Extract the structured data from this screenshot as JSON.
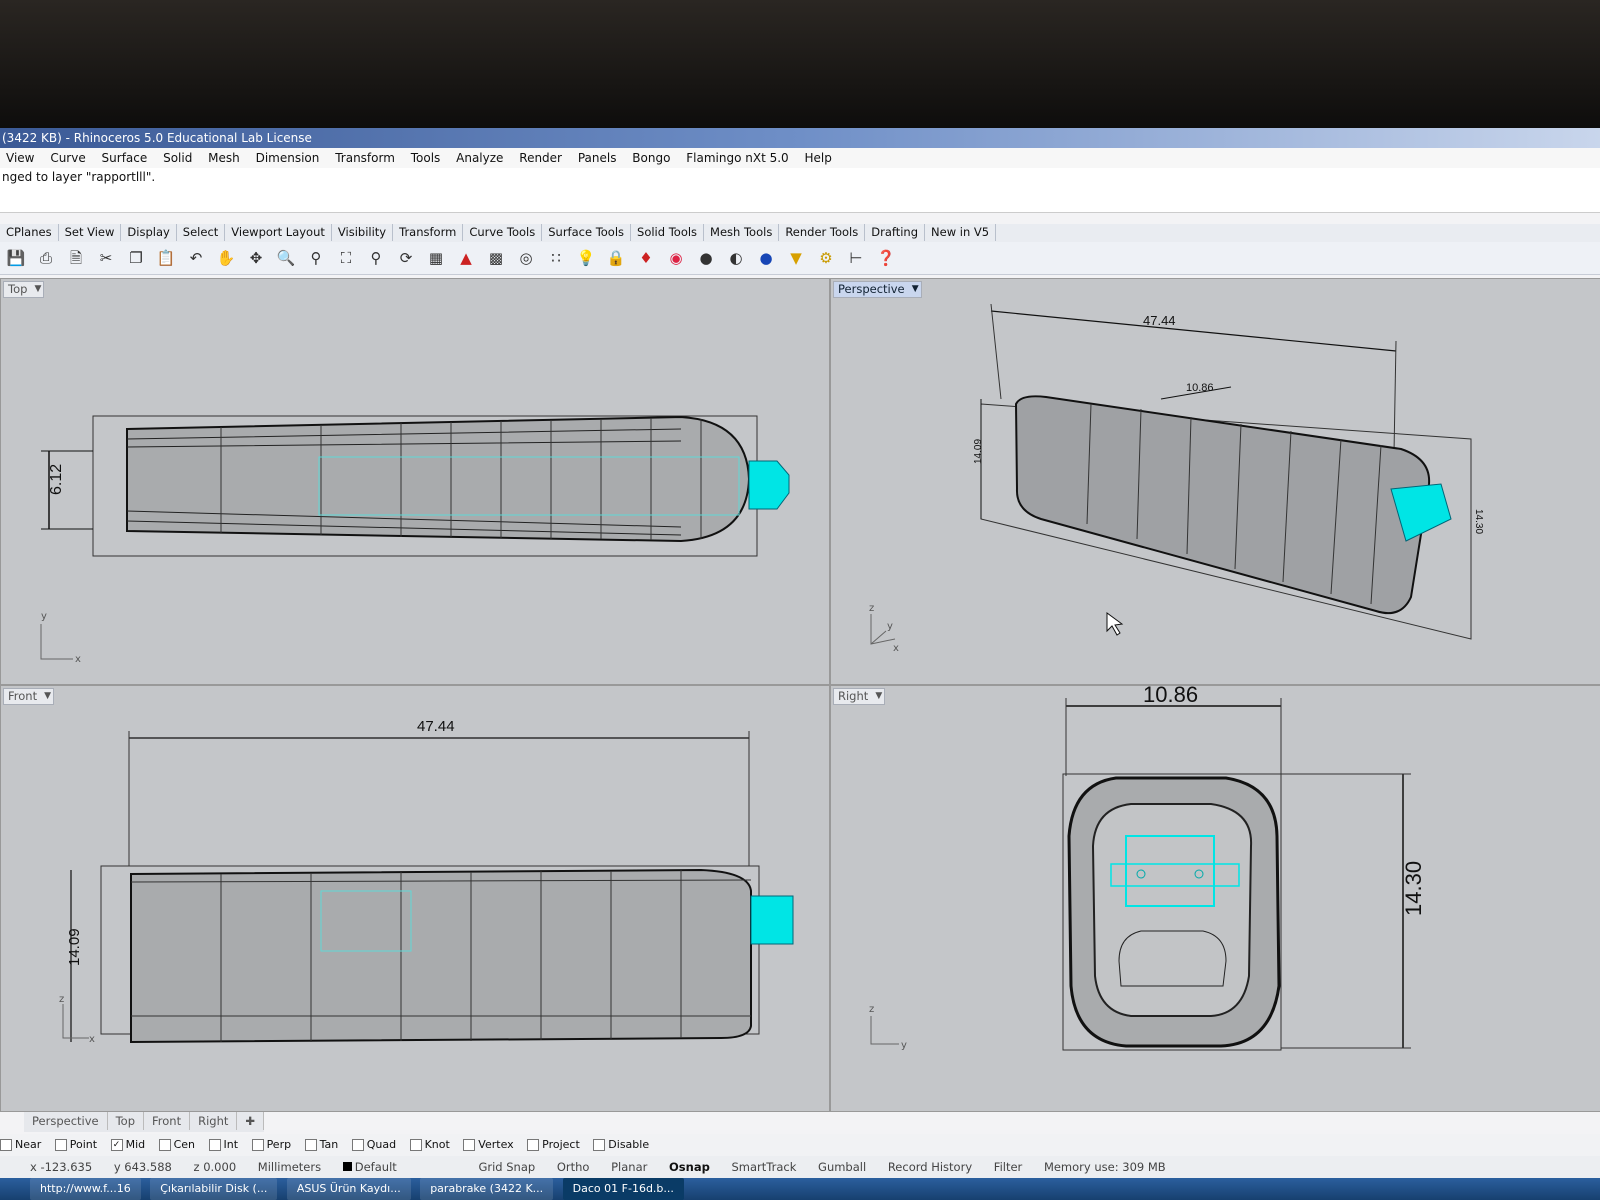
{
  "window": {
    "title": "(3422 KB) - Rhinoceros 5.0 Educational Lab License"
  },
  "menu": [
    "View",
    "Curve",
    "Surface",
    "Solid",
    "Mesh",
    "Dimension",
    "Transform",
    "Tools",
    "Analyze",
    "Render",
    "Panels",
    "Bongo",
    "Flamingo nXt 5.0",
    "Help"
  ],
  "command_history": "nged to layer \"rapportlll\".",
  "toolbar_tabs": [
    "CPlanes",
    "Set View",
    "Display",
    "Select",
    "Viewport Layout",
    "Visibility",
    "Transform",
    "Curve Tools",
    "Surface Tools",
    "Solid Tools",
    "Mesh Tools",
    "Render Tools",
    "Drafting",
    "New in V5"
  ],
  "toolbar_icons": [
    "save-icon",
    "print-icon",
    "new-doc-icon",
    "cut-icon",
    "copy-icon",
    "paste-icon",
    "undo-icon",
    "pan-hand-icon",
    "rotate-icon",
    "zoom-window-icon",
    "zoom-dynamic-icon",
    "zoom-extents-icon",
    "zoom-selected-icon",
    "rotate-view-icon",
    "four-view-icon",
    "car-icon",
    "grid-icon",
    "circle-snap-icon",
    "points-icon",
    "light-bulb-icon",
    "lock-icon",
    "layer-icon",
    "color-wheel-icon",
    "render-sphere-icon",
    "shaded-sphere-icon",
    "blue-sphere-icon",
    "cone-icon",
    "gear-icon",
    "dimension-icon",
    "help-icon"
  ],
  "viewports": {
    "top": {
      "label": "Top",
      "dims": [
        "6.12"
      ],
      "axes": [
        "y",
        "x"
      ]
    },
    "perspective": {
      "label": "Perspective",
      "dims": [
        "47.44",
        "10.86",
        "14.09",
        "14.30"
      ],
      "axes": [
        "z",
        "y",
        "x"
      ]
    },
    "front": {
      "label": "Front",
      "dims": [
        "47.44",
        "14.09"
      ],
      "axes": [
        "z",
        "x"
      ]
    },
    "right": {
      "label": "Right",
      "dims": [
        "10.86",
        "14.30"
      ],
      "axes": [
        "z",
        "y"
      ]
    }
  },
  "viewport_tabs": [
    "Perspective",
    "Top",
    "Front",
    "Right"
  ],
  "osnap": [
    {
      "label": "Near",
      "checked": false
    },
    {
      "label": "Point",
      "checked": false
    },
    {
      "label": "Mid",
      "checked": true
    },
    {
      "label": "Cen",
      "checked": false
    },
    {
      "label": "Int",
      "checked": false
    },
    {
      "label": "Perp",
      "checked": false
    },
    {
      "label": "Tan",
      "checked": false
    },
    {
      "label": "Quad",
      "checked": false
    },
    {
      "label": "Knot",
      "checked": false
    },
    {
      "label": "Vertex",
      "checked": false
    },
    {
      "label": "Project",
      "checked": false
    },
    {
      "label": "Disable",
      "checked": false
    }
  ],
  "status": {
    "x": "x -123.635",
    "y": "y 643.588",
    "z": "z 0.000",
    "units": "Millimeters",
    "layer": "Default",
    "toggles": [
      "Grid Snap",
      "Ortho",
      "Planar",
      "Osnap",
      "SmartTrack",
      "Gumball",
      "Record History",
      "Filter"
    ],
    "memory": "Memory use: 309 MB"
  },
  "taskbar": [
    "http://www.f...16",
    "Çıkarılabilir Disk (...",
    "ASUS Ürün Kaydı...",
    "parabrake (3422 K...",
    "Daco 01 F-16d.b..."
  ],
  "colors": {
    "selection": "#00e5e5",
    "viewport_bg": "#c4c6c9",
    "title_bar": "#3b5a96"
  }
}
